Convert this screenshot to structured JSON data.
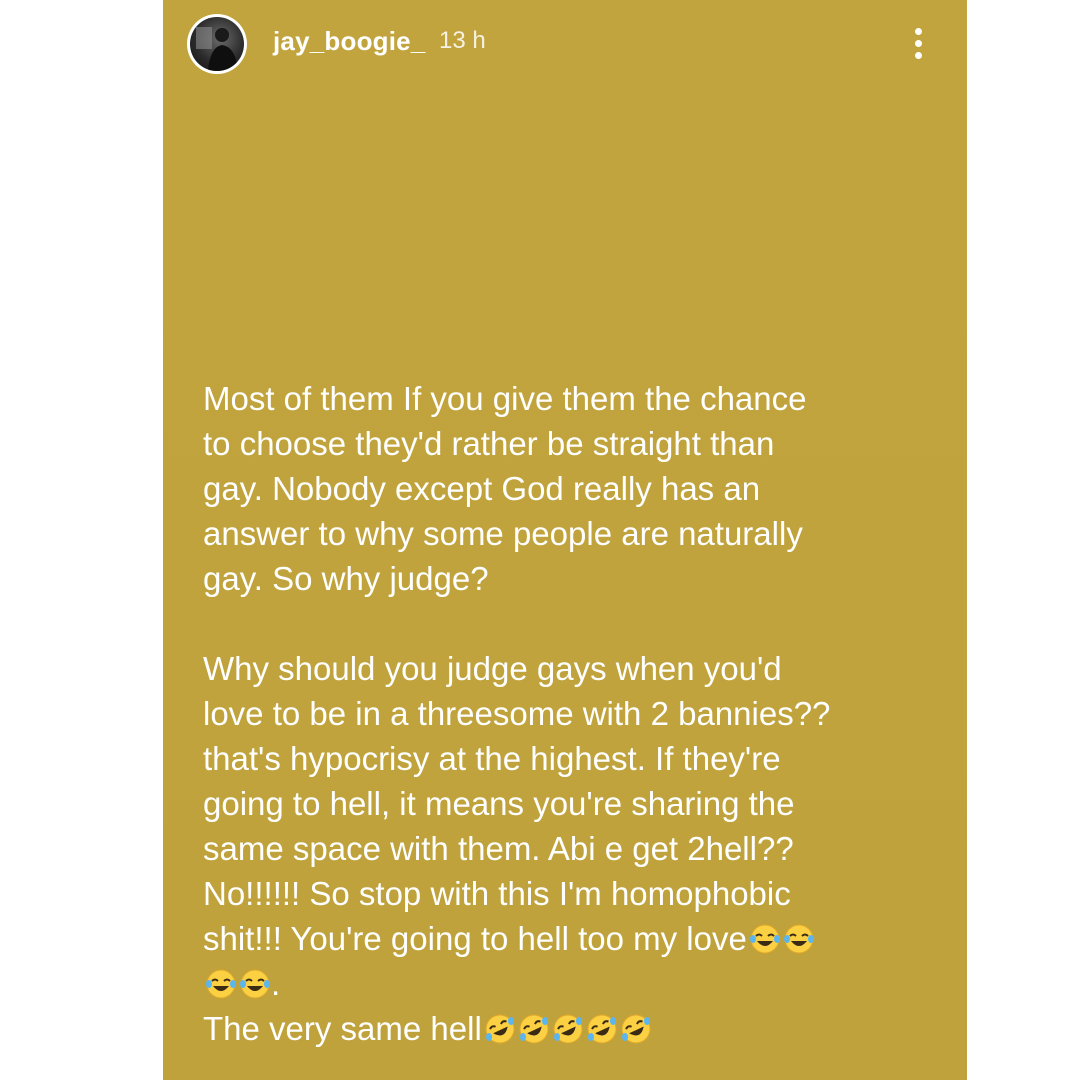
{
  "story": {
    "username": "jay_boogie_",
    "time": "13 h",
    "colors": {
      "background": "#c1a43d",
      "text": "#ffffff"
    },
    "icons": {
      "more": "more-vertical-icon",
      "avatar": "profile-avatar"
    },
    "paragraph1": "Most of them If you give them the chance\nto choose they'd rather be straight than\ngay. Nobody except God really has an\nanswer to why some people are naturally\ngay. So why judge?",
    "paragraph2": "Why should you judge gays when you'd\nlove to be in a threesome with 2 bannies??\nthat's hypocrisy at the highest. If they're\ngoing to hell, it means you're sharing the\nsame space with them. Abi e get 2hell??\nNo!!!!!! So stop with this I'm homophobic\nshit!!! You're going to hell too my love",
    "paragraph2_tail": ".",
    "paragraph3": "The very same hell",
    "emojis": {
      "laughing_count": 4,
      "rolling_count": 5
    }
  }
}
